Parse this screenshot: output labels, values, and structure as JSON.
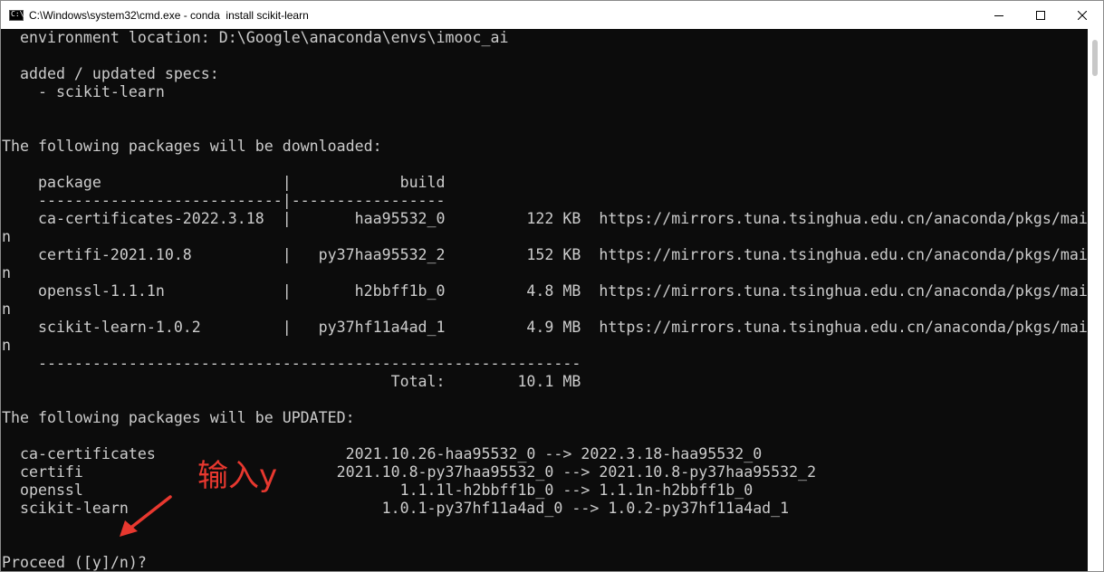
{
  "window": {
    "title": "C:\\Windows\\system32\\cmd.exe - conda  install scikit-learn",
    "icon": "cmd-icon",
    "icon_glyph": "C:\\",
    "controls": [
      "minimize-icon",
      "maximize-icon",
      "close-icon"
    ]
  },
  "console": {
    "lines": [
      "  environment location: D:\\Google\\anaconda\\envs\\imooc_ai",
      "",
      "  added / updated specs:",
      "    - scikit-learn",
      "",
      "",
      "The following packages will be downloaded:",
      "",
      "    package                    |            build",
      "    ---------------------------|-----------------",
      "    ca-certificates-2022.3.18  |       haa95532_0         122 KB  https://mirrors.tuna.tsinghua.edu.cn/anaconda/pkgs/mai",
      "n",
      "    certifi-2021.10.8          |   py37haa95532_2         152 KB  https://mirrors.tuna.tsinghua.edu.cn/anaconda/pkgs/mai",
      "n",
      "    openssl-1.1.1n             |       h2bbff1b_0         4.8 MB  https://mirrors.tuna.tsinghua.edu.cn/anaconda/pkgs/mai",
      "n",
      "    scikit-learn-1.0.2         |   py37hf11a4ad_1         4.9 MB  https://mirrors.tuna.tsinghua.edu.cn/anaconda/pkgs/mai",
      "n",
      "    ------------------------------------------------------------",
      "                                           Total:        10.1 MB",
      "",
      "The following packages will be UPDATED:",
      "",
      "  ca-certificates                     2021.10.26-haa95532_0 --> 2022.3.18-haa95532_0",
      "  certifi                            2021.10.8-py37haa95532_0 --> 2021.10.8-py37haa95532_2",
      "  openssl                                   1.1.1l-h2bbff1b_0 --> 1.1.1n-h2bbff1b_0",
      "  scikit-learn                            1.0.1-py37hf11a4ad_0 --> 1.0.2-py37hf11a4ad_1",
      "",
      "",
      "Proceed ([y]/n)?"
    ]
  },
  "annotation": {
    "text": "输入y",
    "color": "#e8382f"
  },
  "colors": {
    "console_bg": "#0c0c0c",
    "console_fg": "#cccccc",
    "titlebar_bg": "#ffffff"
  }
}
